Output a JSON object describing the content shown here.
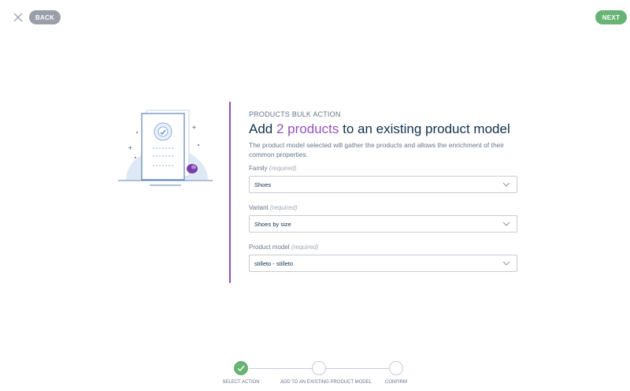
{
  "header": {
    "back_label": "BACK",
    "next_label": "NEXT"
  },
  "form": {
    "subtitle": "PRODUCTS BULK ACTION",
    "title_prefix": "Add ",
    "title_accent": "2 products",
    "title_suffix": " to an existing product model",
    "description": "The product model selected will gather the products and allows the enrichment of their common properties.",
    "fields": [
      {
        "label": "Family",
        "required": "(required)",
        "value": "Shoes"
      },
      {
        "label": "Variant",
        "required": "(required)",
        "value": "Shoes by size"
      },
      {
        "label": "Product model",
        "required": "(required)",
        "value": "stilleto - stilleto"
      }
    ]
  },
  "stepper": {
    "steps": [
      {
        "label": "SELECT ACTION",
        "state": "done"
      },
      {
        "label": "ADD TO AN EXISTING PRODUCT MODEL",
        "state": "pending"
      },
      {
        "label": "CONFIRM",
        "state": "pending"
      }
    ]
  },
  "colors": {
    "accent_purple": "#9452ba",
    "success_green": "#67b373",
    "back_grey": "#9a9ea8"
  }
}
